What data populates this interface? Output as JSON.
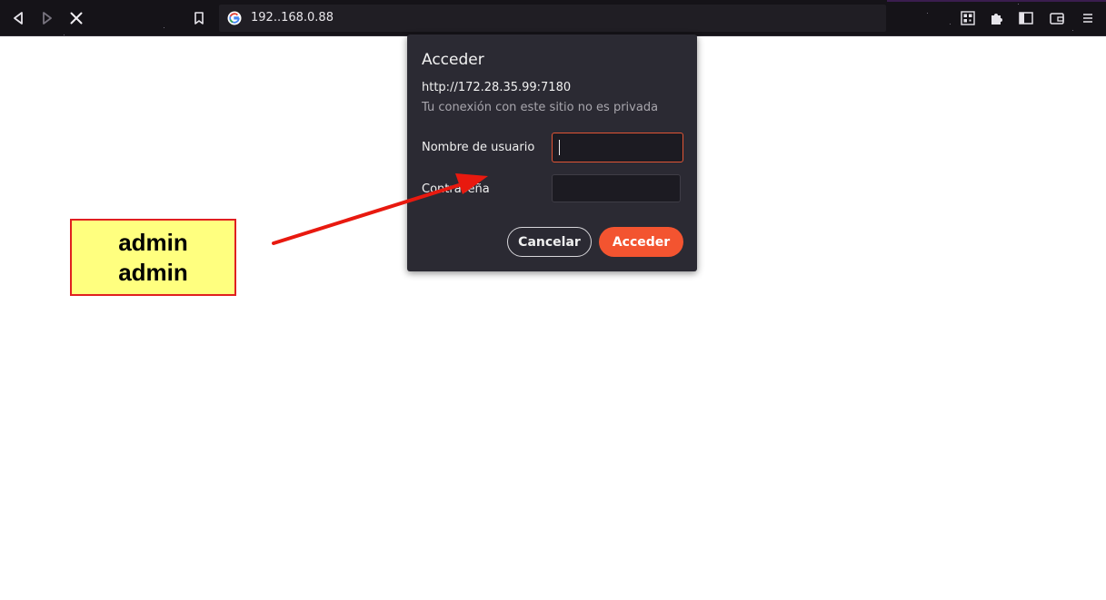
{
  "browser": {
    "url": "192..168.0.88",
    "icons": {
      "back": "back-icon",
      "forward": "forward-icon",
      "stop": "stop-icon",
      "bookmark": "bookmark-icon",
      "site": "google-icon",
      "qr": "qr-code-icon",
      "extensions": "puzzle-icon",
      "sidebar": "sidebar-icon",
      "wallet": "wallet-icon",
      "menu": "menu-icon"
    }
  },
  "dialog": {
    "title": "Acceder",
    "url": "http://172.28.35.99:7180",
    "warning": "Tu conexión con este sitio no es privada",
    "username_label": "Nombre de usuario",
    "username_value": "",
    "password_label": "Contraseña",
    "password_value": "",
    "cancel_label": "Cancelar",
    "submit_label": "Acceder",
    "accent_color": "#f35430"
  },
  "annotation": {
    "line1": "admin",
    "line2": "admin",
    "box_color": "#ffff7f",
    "border_color": "#e02020"
  }
}
